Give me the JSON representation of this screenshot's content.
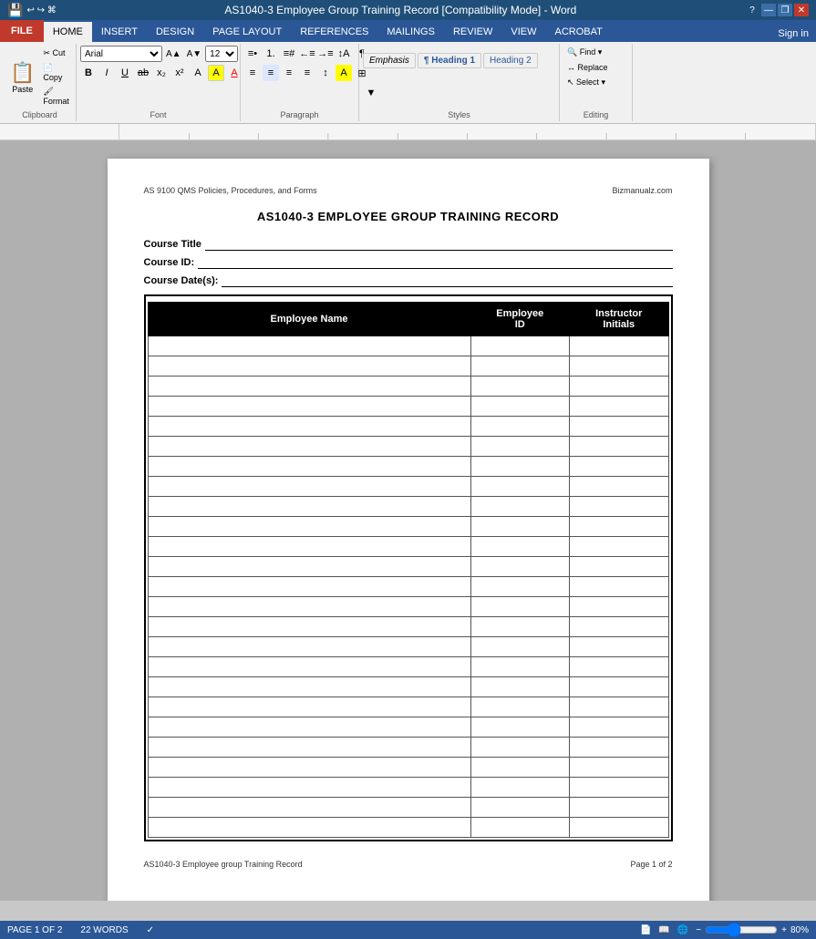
{
  "titlebar": {
    "title": "AS1040-3 Employee Group Training Record [Compatibility Mode] - Word",
    "help": "?",
    "minimize": "—",
    "restore": "❐",
    "close": "✕"
  },
  "ribbon": {
    "tabs": [
      "FILE",
      "HOME",
      "INSERT",
      "DESIGN",
      "PAGE LAYOUT",
      "REFERENCES",
      "MAILINGS",
      "REVIEW",
      "VIEW",
      "ACROBAT"
    ],
    "active_tab": "HOME",
    "sign_in": "Sign in",
    "clipboard_group": "Clipboard",
    "font_group": "Font",
    "paragraph_group": "Paragraph",
    "styles_group": "Styles",
    "editing_group": "Editing",
    "paste_label": "Paste",
    "font_name": "Arial",
    "font_size": "12",
    "bold": "B",
    "italic": "I",
    "underline": "U",
    "styles": [
      "Emphasis",
      "¶ Heading 1",
      "Heading 2"
    ],
    "find_label": "Find",
    "replace_label": "Replace",
    "select_label": "Select"
  },
  "document": {
    "header_left": "AS 9100 QMS Policies, Procedures, and Forms",
    "header_right": "Bizmanualz.com",
    "title": "AS1040-3 EMPLOYEE GROUP TRAINING RECORD",
    "course_title_label": "Course Title",
    "course_id_label": "Course ID:",
    "course_date_label": "Course Date(s):",
    "table": {
      "col1": "Employee Name",
      "col2": "Employee\nID",
      "col3": "Instructor\nInitials",
      "rows": 25
    },
    "footer_left": "AS1040-3 Employee group Training Record",
    "footer_right": "Page 1 of 2"
  },
  "statusbar": {
    "page": "PAGE 1 OF 2",
    "words": "22 WORDS",
    "zoom": "80%"
  }
}
